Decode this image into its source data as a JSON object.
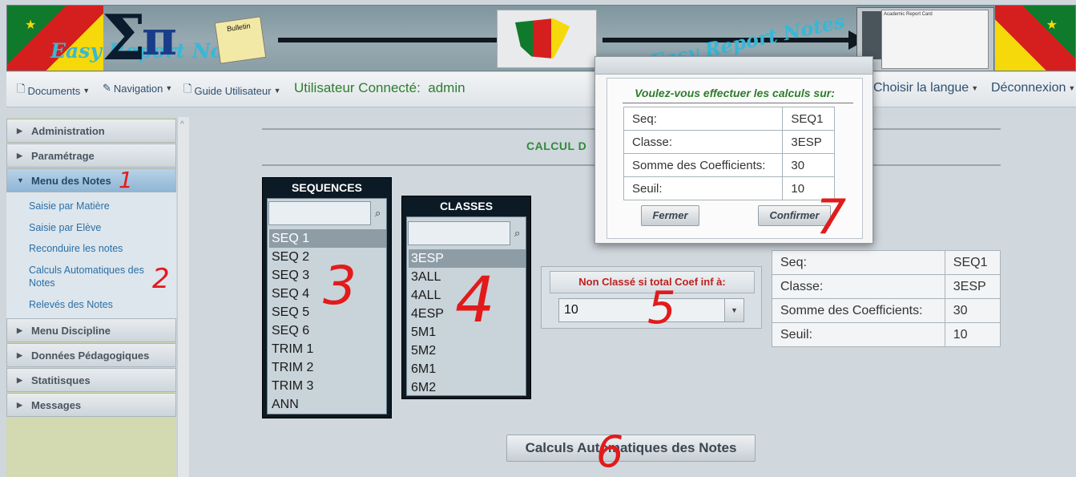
{
  "banner": {
    "logo_line1": "Easy Report Notes",
    "logo_line2": "Easy Report Notes",
    "bulletin_label": "Bulletin",
    "card_title": "Academic Report Card"
  },
  "menubar": {
    "documents": "Documents",
    "navigation": "Navigation",
    "guide": "Guide Utilisateur",
    "user_label": "Utilisateur Connecté:",
    "user_name": "admin",
    "language": "Choisir la langue",
    "logout": "Déconnexion"
  },
  "sidebar": {
    "administration": "Administration",
    "parametrage": "Paramétrage",
    "menu_notes": "Menu des Notes",
    "sub": {
      "saisie_matiere": "Saisie par Matière",
      "saisie_eleve": "Saisie par Elève",
      "reconduire": "Reconduire les notes",
      "calculs_line1": "Calculs Automatiques des",
      "calculs_line2": "Notes",
      "releves": "Relevés des Notes"
    },
    "menu_discipline": "Menu Discipline",
    "donnees": "Données Pédagogiques",
    "statistiques": "Statitisques",
    "messages": "Messages"
  },
  "main": {
    "title": "CALCUL D",
    "sequences": {
      "title": "SEQUENCES",
      "items": [
        "SEQ 1",
        "SEQ 2",
        "SEQ 3",
        "SEQ 4",
        "SEQ 5",
        "SEQ 6",
        "TRIM 1",
        "TRIM 2",
        "TRIM 3",
        "ANN"
      ],
      "selected": "SEQ 1"
    },
    "classes": {
      "title": "CLASSES",
      "items": [
        "3ESP",
        "3ALL",
        "4ALL",
        "4ESP",
        "5M1",
        "5M2",
        "6M1",
        "6M2"
      ],
      "selected": "3ESP"
    },
    "non_classe": {
      "label": "Non Classé si total Coef inf à:",
      "value": "10"
    },
    "summary": {
      "seq_label": "Seq:",
      "seq_value": "SEQ1",
      "classe_label": "Classe:",
      "classe_value": "3ESP",
      "somme_label": "Somme des Coefficients:",
      "somme_value": "30",
      "seuil_label": "Seuil:",
      "seuil_value": "10"
    },
    "calc_button": "Calculs Automatiques des Notes"
  },
  "modal": {
    "question": "Voulez-vous effectuer les calculs sur:",
    "seq_label": "Seq:",
    "seq_value": "SEQ1",
    "classe_label": "Classe:",
    "classe_value": "3ESP",
    "somme_label": "Somme des Coefficients:",
    "somme_value": "30",
    "seuil_label": "Seuil:",
    "seuil_value": "10",
    "close_button": "Fermer",
    "confirm_button": "Confirmer"
  },
  "annotations": [
    "1",
    "2",
    "3",
    "4",
    "5",
    "6",
    "7"
  ],
  "colors": {
    "accent_green": "#2e7d2e",
    "link_blue": "#2a6fa8",
    "warning_red": "#c0201f",
    "annotation_red": "#e11b1b"
  }
}
